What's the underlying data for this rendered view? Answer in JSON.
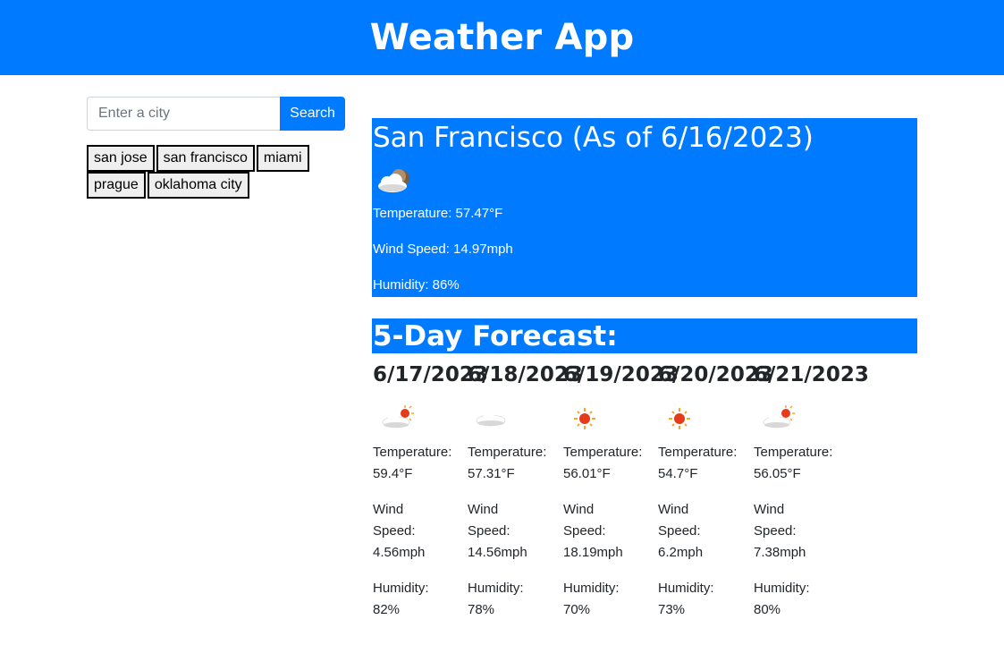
{
  "header": {
    "title": "Weather App"
  },
  "search": {
    "placeholder": "Enter a city",
    "value": "",
    "button_label": "Search"
  },
  "history": [
    "san jose",
    "san francisco",
    "miami",
    "prague",
    "oklahoma city"
  ],
  "current": {
    "title": "San Francisco (As of 6/16/2023)",
    "icon": "cloud-moon-icon",
    "temperature": "Temperature: 57.47°F",
    "wind": "Wind Speed: 14.97mph",
    "humidity": "Humidity: 86%"
  },
  "forecast": {
    "title": "5-Day Forecast:",
    "temperature_label": "Temperature:",
    "wind_label_1": "Wind",
    "wind_label_2": "Speed:",
    "humidity_label": "Humidity:",
    "days": [
      {
        "date": "6/17/2023",
        "icon": "cloud-sun-icon",
        "temp": "59.4°F",
        "wind": "4.56mph",
        "humidity": "82%"
      },
      {
        "date": "6/18/2023",
        "icon": "cloud-icon",
        "temp": "57.31°F",
        "wind": "14.56mph",
        "humidity": "78%"
      },
      {
        "date": "6/19/2023",
        "icon": "sun-icon",
        "temp": "56.01°F",
        "wind": "18.19mph",
        "humidity": "70%"
      },
      {
        "date": "6/20/2023",
        "icon": "sun-icon",
        "temp": "54.7°F",
        "wind": "6.2mph",
        "humidity": "73%"
      },
      {
        "date": "6/21/2023",
        "icon": "cloud-sun-icon",
        "temp": "56.05°F",
        "wind": "7.38mph",
        "humidity": "80%"
      }
    ]
  }
}
